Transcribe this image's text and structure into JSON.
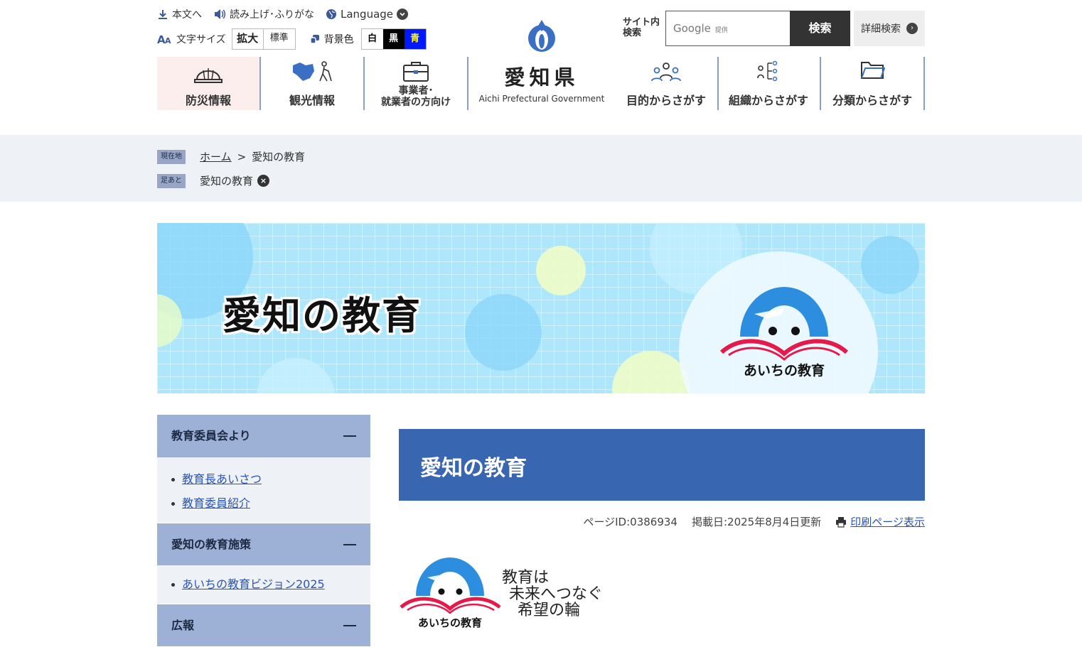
{
  "utility": {
    "skip": "本文へ",
    "read": "読み上げ･ふりがな",
    "language": "Language",
    "font_size_label": "文字サイズ",
    "font_big": "拡大",
    "font_std": "標準",
    "bg_label": "背景色",
    "bg_white": "白",
    "bg_black": "黒",
    "bg_blue": "青"
  },
  "logo": {
    "name": "愛知県",
    "en": "Aichi Prefectural Government"
  },
  "search": {
    "label_line1": "サイト内",
    "label_line2": "検索",
    "google": "Google",
    "provided": "提供",
    "button": "検索",
    "advanced": "詳細検索"
  },
  "nav": {
    "disaster": "防災情報",
    "tourism": "観光情報",
    "business_line1": "事業者･",
    "business_line2": "就業者の方向け",
    "purpose": "目的からさがす",
    "organization": "組織からさがす",
    "category": "分類からさがす"
  },
  "breadcrumb": {
    "current_tag": "現在地",
    "home": "ホーム",
    "separator": ">",
    "current": "愛知の教育",
    "history_tag": "足あと",
    "history_item": "愛知の教育"
  },
  "banner": {
    "title": "愛知の教育",
    "logo_caption": "あいちの教育"
  },
  "sidebar": {
    "sections": [
      {
        "title": "教育委員会より",
        "links": [
          "教育長あいさつ",
          "教育委員紹介"
        ]
      },
      {
        "title": "愛知の教育施策",
        "links": [
          "あいちの教育ビジョン2025"
        ]
      },
      {
        "title": "広報",
        "links": []
      }
    ]
  },
  "main": {
    "title": "愛知の教育",
    "page_id": "ページID:0386934",
    "posted": "掲載日:2025年8月4日更新",
    "print": "印刷ページ表示",
    "logo_caption": "あいちの教育",
    "slogan": [
      "教育は",
      "未来へつなぐ",
      "希望の輪"
    ]
  },
  "colors": {
    "nav_divider": "#8aa0c8",
    "title_bg": "#3966b0",
    "sidebar_head": "#9db0d6",
    "link": "#2a55b8"
  }
}
